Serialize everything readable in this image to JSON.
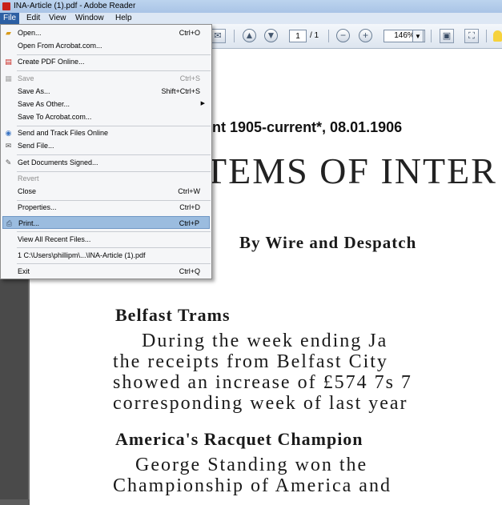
{
  "window": {
    "title": "INA-Article (1).pdf - Adobe Reader"
  },
  "menubar": {
    "items": [
      "File",
      "Edit",
      "View",
      "Window",
      "Help"
    ]
  },
  "toolbar": {
    "page_current": "1",
    "page_total": "/ 1",
    "zoom": "146%"
  },
  "file_menu": {
    "open": {
      "label": "Open...",
      "shortcut": "Ctrl+O"
    },
    "open_from_acrobat": {
      "label": "Open From Acrobat.com..."
    },
    "create_pdf_online": {
      "label": "Create PDF Online..."
    },
    "save": {
      "label": "Save",
      "shortcut": "Ctrl+S"
    },
    "save_as": {
      "label": "Save As...",
      "shortcut": "Shift+Ctrl+S"
    },
    "save_as_other": {
      "label": "Save As Other..."
    },
    "save_to_acrobat": {
      "label": "Save To Acrobat.com..."
    },
    "send_and_track": {
      "label": "Send and Track Files Online"
    },
    "send_file": {
      "label": "Send File..."
    },
    "get_signed": {
      "label": "Get Documents Signed..."
    },
    "revert": {
      "label": "Revert"
    },
    "close": {
      "label": "Close",
      "shortcut": "Ctrl+W"
    },
    "properties": {
      "label": "Properties...",
      "shortcut": "Ctrl+D"
    },
    "print": {
      "label": "Print...",
      "shortcut": "Ctrl+P"
    },
    "view_recent": {
      "label": "View All Recent Files..."
    },
    "recent_1": {
      "label": "1 C:\\Users\\phillipm\\...\\INA-Article (1).pdf"
    },
    "exit": {
      "label": "Exit",
      "shortcut": "Ctrl+Q"
    }
  },
  "document": {
    "meta_line": "ent 1905-current*, 08.01.1906",
    "headline": "TEMS OF INTER",
    "byline": "By Wire and Despatch",
    "section1_title": "Belfast Trams",
    "section1_lines": [
      "During the week ending Ja",
      "the receipts from Belfast City",
      "showed an increase of £574 7s 7",
      "corresponding week of last year"
    ],
    "section2_title": "America's Racquet Champion",
    "section2_lines": [
      "George Standing won the",
      "Championship of America and"
    ]
  }
}
